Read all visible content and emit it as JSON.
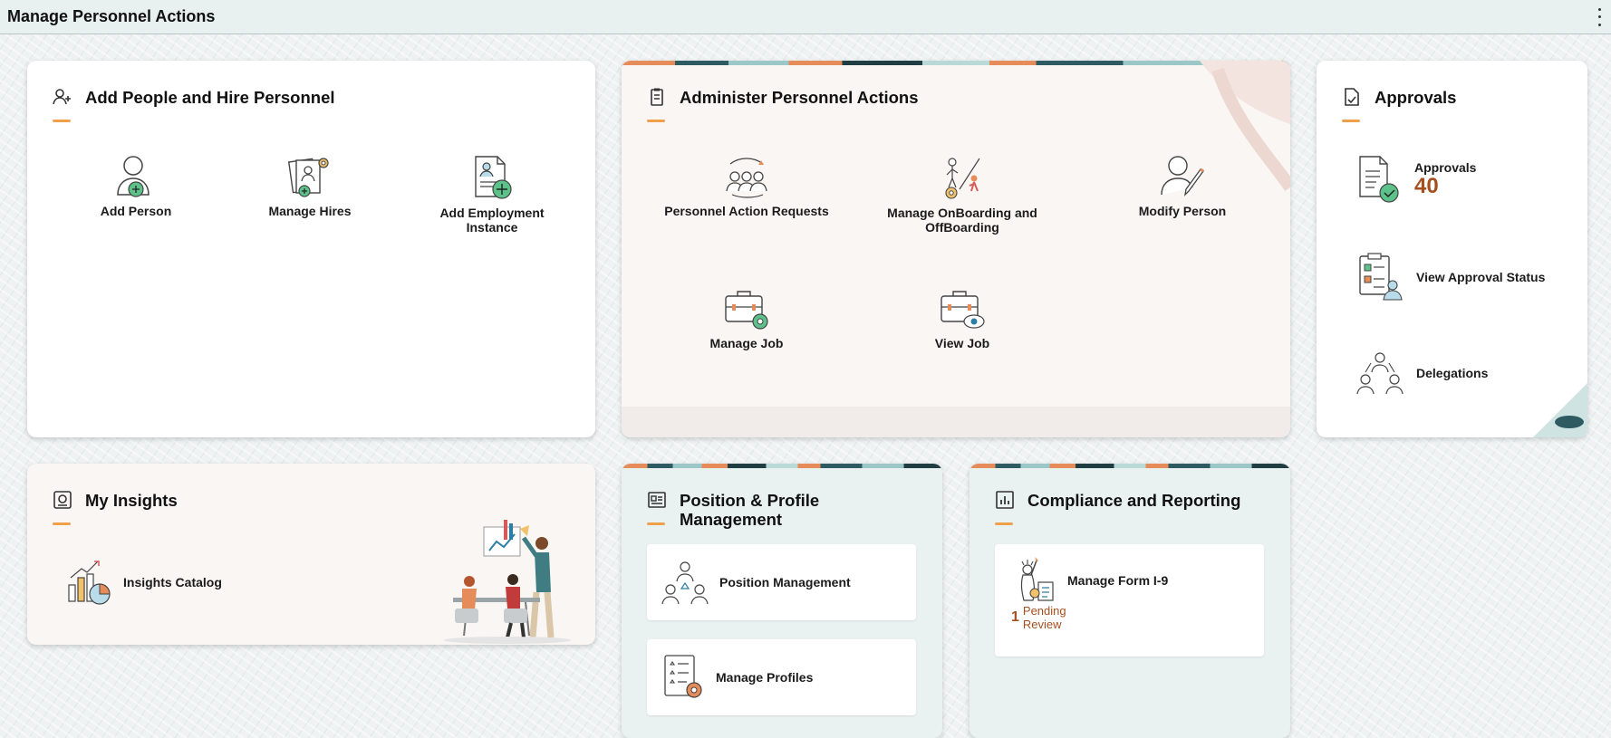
{
  "page": {
    "title": "Manage Personnel Actions"
  },
  "tiles": {
    "add_people": {
      "title": "Add People and Hire Personnel",
      "actions": [
        "Add Person",
        "Manage Hires",
        "Add Employment Instance"
      ]
    },
    "administer": {
      "title": "Administer Personnel Actions",
      "actions": [
        "Personnel Action Requests",
        "Manage OnBoarding and OffBoarding",
        "Modify Person",
        "Manage Job",
        "View Job"
      ]
    },
    "approvals": {
      "title": "Approvals",
      "items": [
        {
          "label": "Approvals",
          "count": "40"
        },
        {
          "label": "View Approval Status"
        },
        {
          "label": "Delegations"
        }
      ]
    },
    "insights": {
      "title": "My Insights",
      "items": [
        "Insights Catalog"
      ]
    },
    "position": {
      "title": "Position & Profile Management",
      "items": [
        "Position Management",
        "Manage Profiles"
      ]
    },
    "compliance": {
      "title": "Compliance and Reporting",
      "items": [
        {
          "label": "Manage Form I-9",
          "pending_count": "1",
          "pending_label": "Pending Review"
        }
      ]
    }
  },
  "colors": {
    "accent": "#f0a04b",
    "count": "#a64f1e",
    "icon_green": "#5cc28a"
  }
}
